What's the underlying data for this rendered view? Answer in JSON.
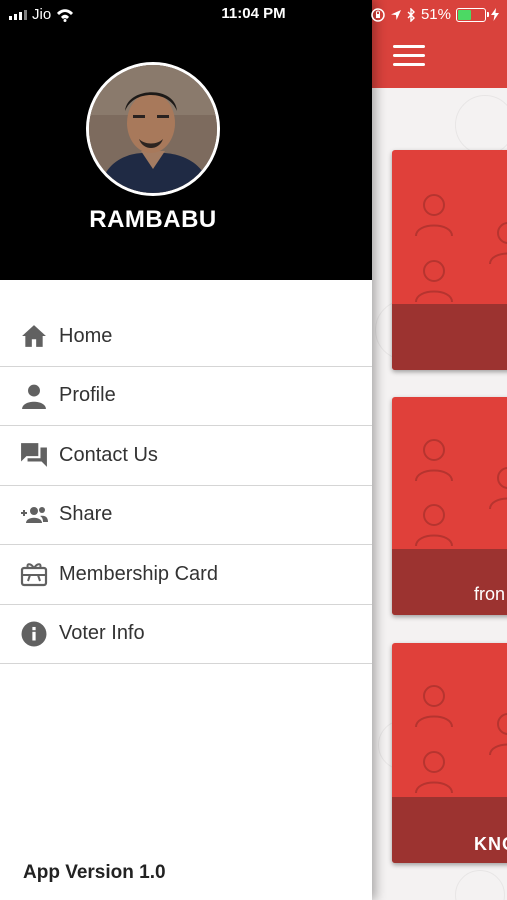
{
  "status_bar": {
    "carrier": "Jio",
    "time": "11:04 PM",
    "battery_percent": "51%",
    "battery_level": 0.51,
    "icons": [
      "signal-icon",
      "wifi-icon",
      "orientation-lock-icon",
      "location-icon",
      "bluetooth-icon",
      "battery-icon",
      "charging-icon"
    ]
  },
  "drawer": {
    "user_name": "RAMBABU",
    "menu": [
      {
        "label": "Home",
        "icon": "home-icon"
      },
      {
        "label": "Profile",
        "icon": "person-icon"
      },
      {
        "label": "Contact Us",
        "icon": "chat-icon"
      },
      {
        "label": "Share",
        "icon": "add-people-icon"
      },
      {
        "label": "Membership Card",
        "icon": "card-gift-icon"
      },
      {
        "label": "Voter Info",
        "icon": "info-icon"
      }
    ],
    "app_version": "App Version 1.0"
  },
  "background_app": {
    "header_icon": "hamburger-menu-icon",
    "cards": [
      {
        "footer_text": ""
      },
      {
        "footer_text": "fron"
      },
      {
        "footer_text": "KNO"
      }
    ]
  },
  "colors": {
    "header_red": "#d9423c",
    "card_red": "#e0403a",
    "card_footer": "#9c3330",
    "drawer_header": "#000000",
    "battery_green": "#4cd964"
  }
}
